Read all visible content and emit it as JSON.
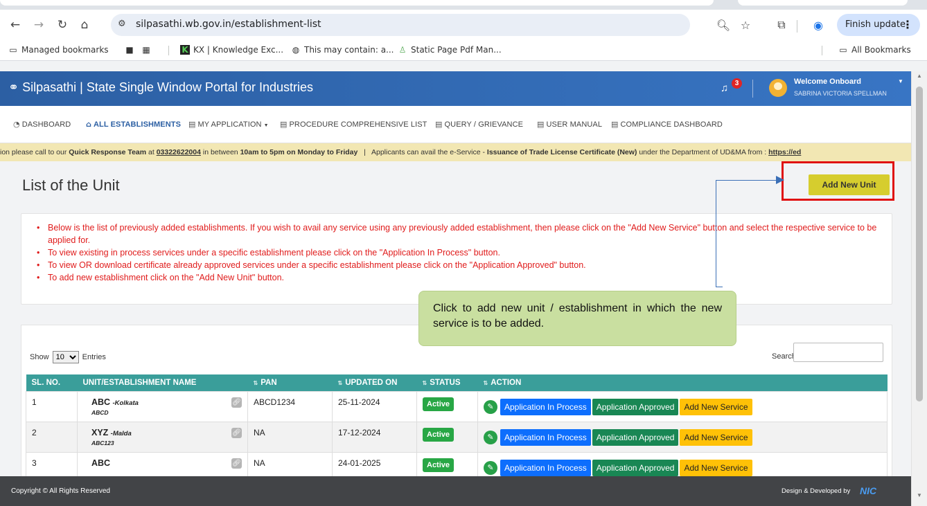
{
  "browser": {
    "url": "silpasathi.wb.gov.in/establishment-list",
    "finish_update": "Finish update",
    "bookmarks": [
      {
        "label": "Managed bookmarks",
        "icon": "managed-bookmarks-icon"
      },
      {
        "label": "KX | Knowledge Exc...",
        "icon": "kx-favicon"
      },
      {
        "label": "This may contain: a...",
        "icon": "globe-icon"
      },
      {
        "label": "Static Page Pdf Man...",
        "icon": "emblem-favicon"
      }
    ],
    "all_bookmarks": "All Bookmarks"
  },
  "header": {
    "title": "Silpasathi | State Single Window Portal for Industries",
    "notification_count": "3",
    "welcome": "Welcome Onboard",
    "user_name": "SABRINA VICTORIA SPELLMAN",
    "brand_color": "#2c5fa3"
  },
  "menu": {
    "dashboard": "DASHBOARD",
    "all_establishments": "ALL ESTABLISHMENTS",
    "my_application": "MY APPLICATION",
    "procedure_list": "PROCEDURE COMPREHENSIVE LIST",
    "query": "QUERY / GRIEVANCE",
    "user_manual": "USER MANUAL",
    "compliance": "COMPLIANCE DASHBOARD"
  },
  "ticker": {
    "t1": "ion please call to our ",
    "qrt": "Quick Response Team",
    "t2": " at ",
    "phone": "03322622004",
    "t3": " in between ",
    "hours": "10am to 5pm on Monday to Friday",
    "t4": "   |   Applicants can avail the e-Service - ",
    "service": "Issuance of Trade License Certificate (New)",
    "t5": " under the Department of UD&MA from : ",
    "link": "https://ed"
  },
  "page": {
    "title": "List of the Unit",
    "add_new_unit": "Add New Unit",
    "notes": [
      "Below is the list of previously added establishments. If you wish to avail any service using any previously added establishment, then please click on the \"Add New Service\" button and select the respective service to be applied for.",
      "To view existing in process services under a specific establishment please click on the \"Application In Process\" button.",
      "To view OR download certificate already approved services under a specific establishment please click on the \"Application Approved\" button.",
      "To add new establishment click on the \"Add New Unit\" button."
    ],
    "callout": "Click to add new unit / establishment in which the new service is to be added."
  },
  "table": {
    "show": "Show",
    "entries_value": "10",
    "entries": "Entries",
    "search_label": "Search:",
    "columns": [
      "SL. NO.",
      "UNIT/ESTABLISHMENT NAME",
      "PAN",
      "UPDATED ON",
      "STATUS",
      "ACTION"
    ],
    "rows": [
      {
        "sl": "1",
        "name": "ABC",
        "city": "-Kolkata",
        "code": "ABCD",
        "pan": "ABCD1234",
        "updated": "25-11-2024",
        "status": "Active"
      },
      {
        "sl": "2",
        "name": "XYZ",
        "city": "-Malda",
        "code": "ABC123",
        "pan": "NA",
        "updated": "17-12-2024",
        "status": "Active"
      },
      {
        "sl": "3",
        "name": "ABC",
        "city": "",
        "code": "",
        "pan": "NA",
        "updated": "24-01-2025",
        "status": "Active"
      }
    ],
    "btn_in_process": "Application In Process",
    "btn_approved": "Application Approved",
    "btn_add_service": "Add New Service"
  },
  "footer": {
    "copyright": "Copyright © All Rights Reserved",
    "developed": "Design & Developed by",
    "nic": "NIC"
  }
}
